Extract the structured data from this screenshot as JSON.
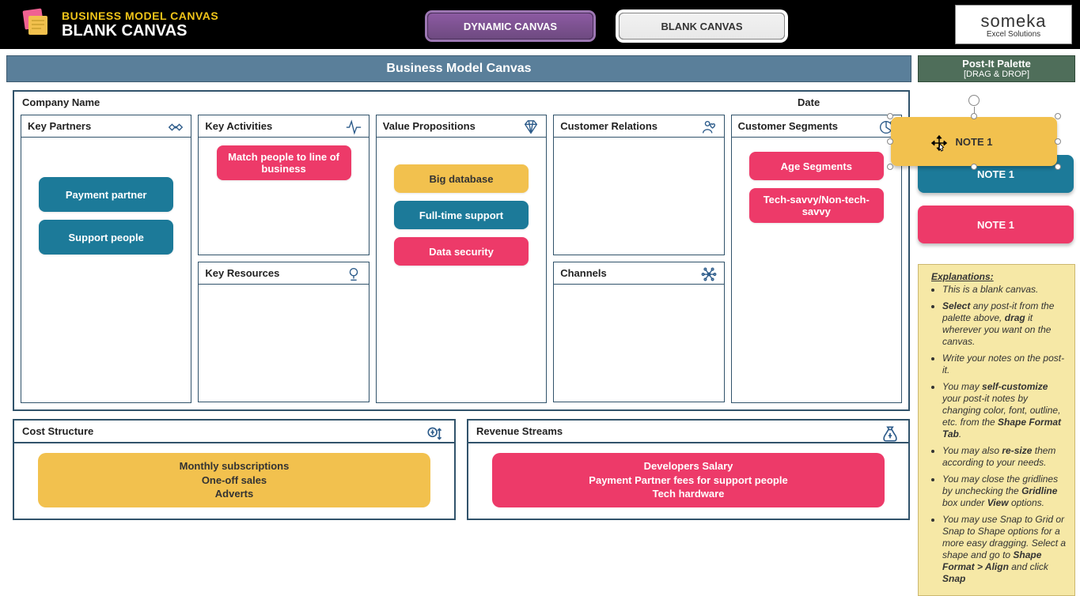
{
  "header": {
    "title": "BUSINESS MODEL CANVAS",
    "subtitle": "BLANK CANVAS",
    "tabs": {
      "dynamic": "DYNAMIC CANVAS",
      "blank": "BLANK CANVAS"
    },
    "brand": {
      "name": "someka",
      "sub": "Excel Solutions"
    }
  },
  "canvas": {
    "title": "Business Model Canvas",
    "company_label": "Company Name",
    "date_label": "Date",
    "sections": {
      "key_partners": {
        "label": "Key Partners",
        "notes": [
          "Payment partner",
          "Support people"
        ]
      },
      "key_activities": {
        "label": "Key Activities",
        "notes": [
          "Match people to  line of business"
        ]
      },
      "key_resources": {
        "label": "Key Resources",
        "notes": []
      },
      "value_propositions": {
        "label": "Value Propositions",
        "notes": [
          "Big database",
          "Full-time support",
          "Data security"
        ]
      },
      "customer_relations": {
        "label": "Customer Relations",
        "notes": []
      },
      "channels": {
        "label": "Channels",
        "notes": []
      },
      "customer_segments": {
        "label": "Customer Segments",
        "notes": [
          "Age Segments",
          "Tech-savvy/Non-tech-savvy"
        ]
      },
      "cost_structure": {
        "label": "Cost Structure",
        "notes": [
          "Monthly subscriptions",
          "One-off sales",
          "Adverts"
        ]
      },
      "revenue_streams": {
        "label": "Revenue Streams",
        "notes": [
          "Developers Salary",
          "Payment Partner fees for support people",
          "Tech hardware"
        ]
      }
    }
  },
  "palette": {
    "title": "Post-It Palette",
    "subtitle": "[DRAG & DROP]",
    "notes": [
      {
        "label": "NOTE 1",
        "color": "gold"
      },
      {
        "label": "NOTE 1",
        "color": "teal"
      },
      {
        "label": "NOTE 1",
        "color": "pink"
      }
    ],
    "floating_label": "NOTE 1"
  },
  "instructions": {
    "header": "Explanations:",
    "items": [
      "This is a blank canvas.",
      "<b>Select</b> any post-it from the palette above, <b>drag</b> it wherever you want on the canvas.",
      "Write your notes on the post-it.",
      "You may <b>self-customize</b> your post-it notes by changing color, font, outline, etc. from the <b>Shape Format Tab</b>.",
      "You may also <b>re-size</b> them according to your needs.",
      "You may close the  gridlines by unchecking the <b>Gridline</b> box under <b>View</b> options.",
      "You may use Snap to Grid or Snap to Shape options for a more easy dragging. Select a shape and go to <b>Shape Format > Align</b> and click <b>Snap</b>"
    ]
  }
}
